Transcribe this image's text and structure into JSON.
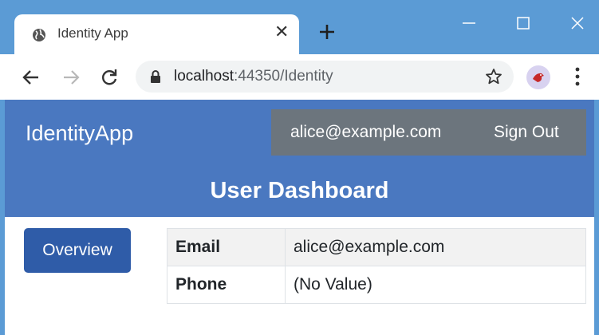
{
  "browser": {
    "tab_title": "Identity App",
    "url_host": "localhost",
    "url_path": ":44350/Identity"
  },
  "icons": {
    "tab": "globe-icon",
    "tab_close": "close-icon",
    "new_tab": "plus-icon",
    "minimize": "minimize-icon",
    "maximize": "maximize-icon",
    "close_window": "close-icon",
    "back": "arrow-left-icon",
    "forward": "arrow-right-icon",
    "reload": "reload-icon",
    "lock": "lock-icon",
    "bookmark": "star-icon",
    "profile": "profile-avatar",
    "menu": "kebab-menu-icon"
  },
  "colors": {
    "chrome_frame": "#5b9bd5",
    "header_bg": "#4a78c0",
    "user_box_bg": "#6c757d",
    "primary_button": "#2f5ca8"
  },
  "app": {
    "brand": "IdentityApp",
    "user_email": "alice@example.com",
    "sign_out_label": "Sign Out",
    "page_title": "User Dashboard"
  },
  "sidebar": {
    "overview_label": "Overview"
  },
  "details": {
    "rows": [
      {
        "key": "Email",
        "value": "alice@example.com"
      },
      {
        "key": "Phone",
        "value": "(No Value)"
      }
    ]
  }
}
